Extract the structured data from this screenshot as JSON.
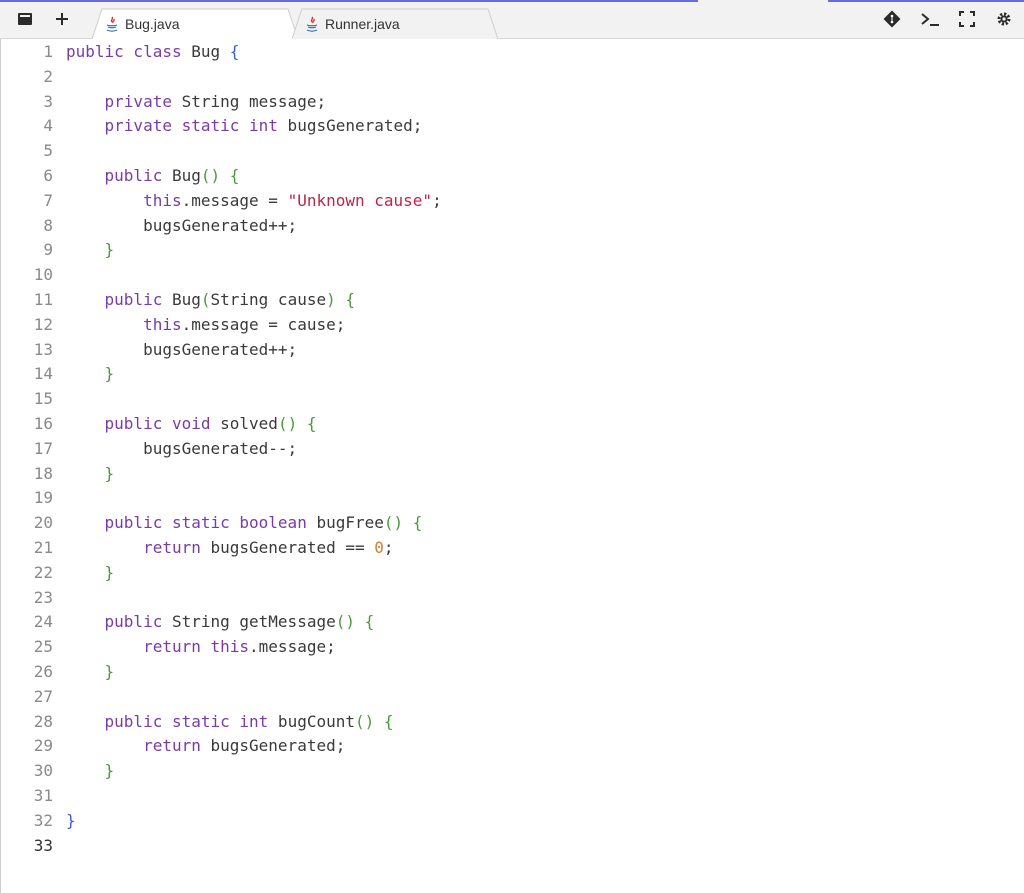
{
  "tabs": [
    {
      "label": "Bug.java",
      "active": true
    },
    {
      "label": "Runner.java",
      "active": false
    }
  ],
  "toolbar": {
    "icons": [
      "file-icon",
      "plus-icon",
      "git-icon",
      "terminal-icon",
      "fullscreen-icon",
      "gear-icon"
    ]
  },
  "colors": {
    "keyword": "#7a3ba8",
    "string": "#c0244a",
    "number": "#e07a2a",
    "method_paren": "#4a9a3a",
    "class_brace": "#3b5bd0"
  },
  "current_line": 33,
  "lines": [
    [
      {
        "t": "public class",
        "c": "kw"
      },
      {
        "t": " Bug "
      },
      {
        "t": "{",
        "c": "cb"
      }
    ],
    [],
    [
      {
        "t": "    "
      },
      {
        "t": "private",
        "c": "kw"
      },
      {
        "t": " String message;"
      }
    ],
    [
      {
        "t": "    "
      },
      {
        "t": "private static int",
        "c": "kw"
      },
      {
        "t": " bugsGenerated;"
      }
    ],
    [],
    [
      {
        "t": "    "
      },
      {
        "t": "public",
        "c": "kw"
      },
      {
        "t": " Bug"
      },
      {
        "t": "() {",
        "c": "br"
      }
    ],
    [
      {
        "t": "        "
      },
      {
        "t": "this",
        "c": "this"
      },
      {
        "t": ".message = "
      },
      {
        "t": "\"Unknown cause\"",
        "c": "str"
      },
      {
        "t": ";"
      }
    ],
    [
      {
        "t": "        bugsGenerated++;"
      }
    ],
    [
      {
        "t": "    "
      },
      {
        "t": "}",
        "c": "br"
      }
    ],
    [],
    [
      {
        "t": "    "
      },
      {
        "t": "public",
        "c": "kw"
      },
      {
        "t": " Bug"
      },
      {
        "t": "(",
        "c": "br"
      },
      {
        "t": "String cause"
      },
      {
        "t": ") {",
        "c": "br"
      }
    ],
    [
      {
        "t": "        "
      },
      {
        "t": "this",
        "c": "this"
      },
      {
        "t": ".message = cause;"
      }
    ],
    [
      {
        "t": "        bugsGenerated++;"
      }
    ],
    [
      {
        "t": "    "
      },
      {
        "t": "}",
        "c": "br"
      }
    ],
    [],
    [
      {
        "t": "    "
      },
      {
        "t": "public void",
        "c": "kw"
      },
      {
        "t": " solved"
      },
      {
        "t": "() {",
        "c": "br"
      }
    ],
    [
      {
        "t": "        bugsGenerated--;"
      }
    ],
    [
      {
        "t": "    "
      },
      {
        "t": "}",
        "c": "br"
      }
    ],
    [],
    [
      {
        "t": "    "
      },
      {
        "t": "public static boolean",
        "c": "kw"
      },
      {
        "t": " bugFree"
      },
      {
        "t": "() {",
        "c": "br"
      }
    ],
    [
      {
        "t": "        "
      },
      {
        "t": "return",
        "c": "kw"
      },
      {
        "t": " bugsGenerated == "
      },
      {
        "t": "0",
        "c": "num"
      },
      {
        "t": ";"
      }
    ],
    [
      {
        "t": "    "
      },
      {
        "t": "}",
        "c": "br"
      }
    ],
    [],
    [
      {
        "t": "    "
      },
      {
        "t": "public",
        "c": "kw"
      },
      {
        "t": " String getMessage"
      },
      {
        "t": "() {",
        "c": "br"
      }
    ],
    [
      {
        "t": "        "
      },
      {
        "t": "return",
        "c": "kw"
      },
      {
        "t": " "
      },
      {
        "t": "this",
        "c": "this"
      },
      {
        "t": ".message;"
      }
    ],
    [
      {
        "t": "    "
      },
      {
        "t": "}",
        "c": "br"
      }
    ],
    [],
    [
      {
        "t": "    "
      },
      {
        "t": "public static int",
        "c": "kw"
      },
      {
        "t": " bugCount"
      },
      {
        "t": "() {",
        "c": "br"
      }
    ],
    [
      {
        "t": "        "
      },
      {
        "t": "return",
        "c": "kw"
      },
      {
        "t": " bugsGenerated;"
      }
    ],
    [
      {
        "t": "    "
      },
      {
        "t": "}",
        "c": "br"
      }
    ],
    [],
    [
      {
        "t": "}",
        "c": "cb"
      }
    ],
    []
  ]
}
